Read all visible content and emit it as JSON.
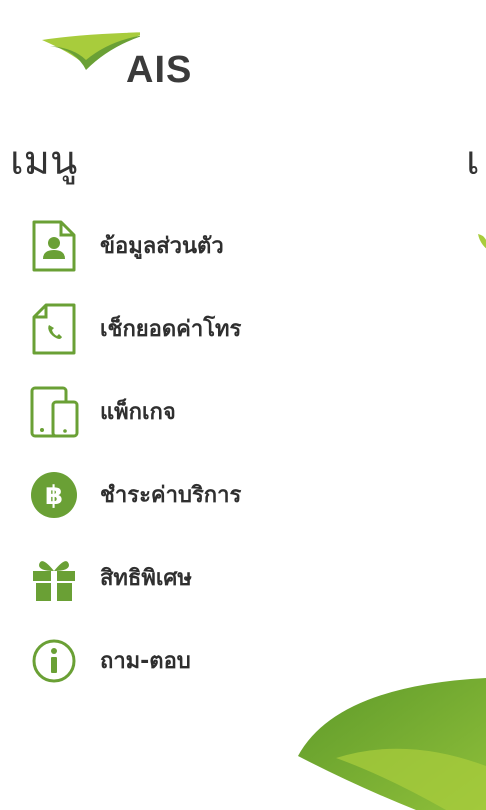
{
  "brand": {
    "name": "AIS"
  },
  "menu": {
    "title": "เมนู",
    "title_next_partial": "เ",
    "items": [
      {
        "label": "ข้อมูลส่วนตัว",
        "icon": "profile-document-icon"
      },
      {
        "label": "เช็กยอดค่าโทร",
        "icon": "phone-document-icon"
      },
      {
        "label": "แพ็กเกจ",
        "icon": "devices-icon"
      },
      {
        "label": "ชำระค่าบริการ",
        "icon": "baht-coin-icon"
      },
      {
        "label": "สิทธิพิเศษ",
        "icon": "gift-icon"
      },
      {
        "label": "ถาม-ตอบ",
        "icon": "info-icon"
      }
    ]
  },
  "colors": {
    "accent_green": "#6aa035",
    "light_green": "#a8cc3c",
    "text": "#2f2f2f"
  }
}
